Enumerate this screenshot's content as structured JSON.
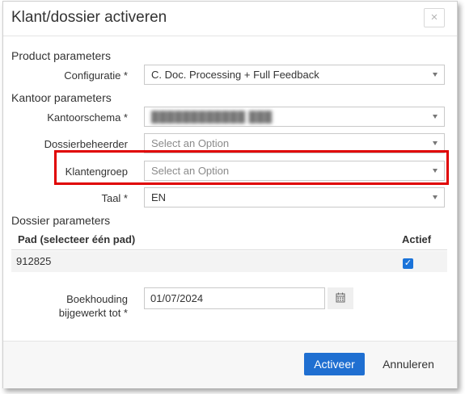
{
  "dialog": {
    "title": "Klant/dossier activeren",
    "close_label": "×"
  },
  "product_section": {
    "heading": "Product parameters",
    "configuratie_label": "Configuratie *",
    "configuratie_value": "C. Doc. Processing + Full Feedback"
  },
  "kantoor_section": {
    "heading": "Kantoor parameters",
    "kantoorschema_label": "Kantoorschema *",
    "kantoorschema_value": "",
    "dossierbeheerder_label": "Dossierbeheerder",
    "dossierbeheerder_placeholder": "Select an Option",
    "klantengroep_label": "Klantengroep",
    "klantengroep_placeholder": "Select an Option",
    "taal_label": "Taal *",
    "taal_value": "EN"
  },
  "dossier_section": {
    "heading": "Dossier parameters",
    "table": {
      "columns": [
        "Pad (selecteer één pad)",
        "Actief"
      ],
      "rows": [
        {
          "pad": "912825",
          "actief": true
        }
      ]
    },
    "boekhouding_label_line1": "Boekhouding",
    "boekhouding_label_line2": "bijgewerkt tot *",
    "boekhouding_value": "01/07/2024"
  },
  "footer": {
    "activate_label": "Activeer",
    "cancel_label": "Annuleren"
  },
  "colors": {
    "primary": "#1f6fd1",
    "highlight": "#e00000",
    "checkbox": "#1a73d9"
  },
  "icons": [
    "close-icon",
    "caret-down-icon",
    "calendar-icon",
    "checkmark-icon"
  ]
}
